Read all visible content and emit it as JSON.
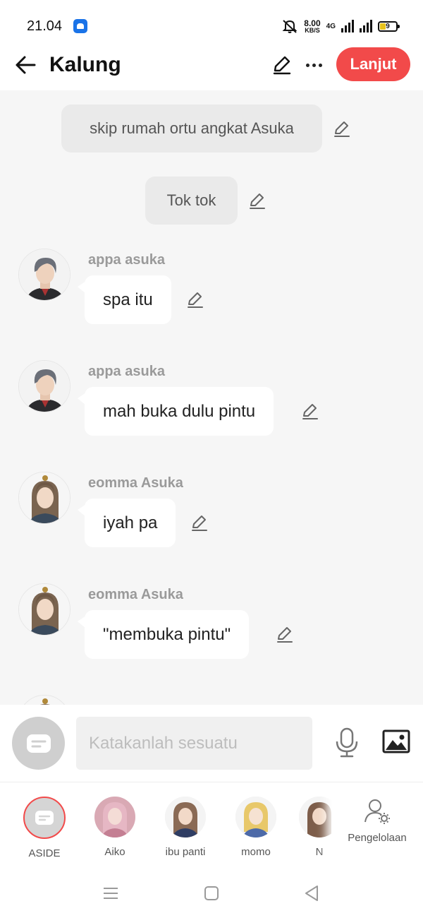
{
  "status_bar": {
    "time": "21.04",
    "net_speed_value": "8.00",
    "net_speed_unit": "KB/S",
    "network_type": "4G",
    "battery_level": "9"
  },
  "header": {
    "title": "Kalung",
    "next_label": "Lanjut",
    "accent_color": "#f24a4a"
  },
  "chat": {
    "narrations": [
      {
        "text": "skip rumah ortu angkat Asuka"
      },
      {
        "text": "Tok tok"
      }
    ],
    "messages": [
      {
        "sender": "appa asuka",
        "text": "spa itu"
      },
      {
        "sender": "appa asuka",
        "text": "mah buka dulu pintu"
      },
      {
        "sender": "eomma Asuka",
        "text": "iyah pa"
      },
      {
        "sender": "eomma Asuka",
        "text": "\"membuka pintu\""
      }
    ]
  },
  "input_bar": {
    "placeholder": "Katakanlah sesuatu"
  },
  "characters": [
    {
      "name": "ASIDE",
      "selected": true
    },
    {
      "name": "Aiko"
    },
    {
      "name": "ibu panti"
    },
    {
      "name": "momo"
    },
    {
      "name": "N"
    }
  ],
  "manage_label": "Pengelolaan"
}
